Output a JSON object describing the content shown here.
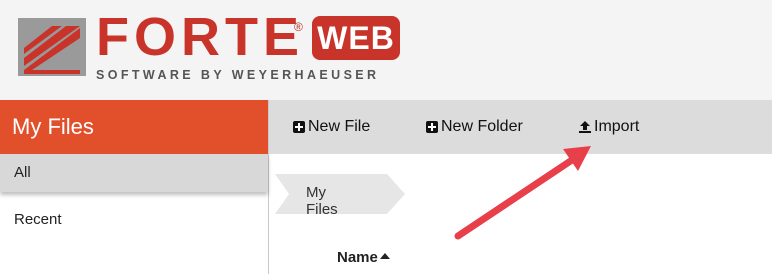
{
  "brand": {
    "wordmark": "FORTE",
    "reg": "®",
    "badge": "WEB",
    "tagline": "SOFTWARE BY WEYERHAEUSER"
  },
  "sidebar": {
    "title": "My Files",
    "items": [
      {
        "label": "All"
      },
      {
        "label": "Recent"
      }
    ]
  },
  "toolbar": {
    "new_file": "New File",
    "new_folder": "New Folder",
    "import": "Import"
  },
  "breadcrumb": {
    "current": "My Files"
  },
  "table": {
    "columns": [
      "Name"
    ]
  },
  "colors": {
    "accent": "#e2502b",
    "brand_red": "#c9342a",
    "annotation_arrow": "#e8404a"
  }
}
